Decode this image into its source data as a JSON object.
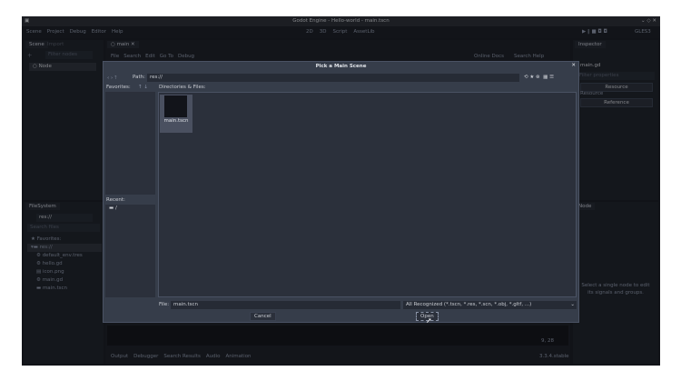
{
  "window": {
    "title": "Godot Engine - Hello-world - main.tscn"
  },
  "menu": [
    "Scene",
    "Project",
    "Debug",
    "Editor",
    "Help"
  ],
  "workspaces": [
    "2D",
    "3D",
    "Script",
    "AssetLib"
  ],
  "renderer": "GLES3",
  "scene_dock": {
    "tabs": [
      "Scene",
      "Import"
    ],
    "filter_placeholder": "Filter nodes",
    "root": "Node"
  },
  "editor": {
    "tab": "main",
    "menu": [
      "File",
      "Search",
      "Edit",
      "Go To",
      "Debug"
    ],
    "online_docs": "Online Docs",
    "search_help": "Search Help",
    "cursor": "9,  28",
    "version": "3.3.4.stable"
  },
  "bottom_tabs": [
    "Output",
    "Debugger",
    "Search Results",
    "Audio",
    "Animation"
  ],
  "filesystem": {
    "title": "FileSystem",
    "path": "res://",
    "search_placeholder": "Search files",
    "items": [
      "Favorites:",
      "res://",
      "default_env.tres",
      "hello.gd",
      "icon.png",
      "main.gd",
      "main.tscn"
    ]
  },
  "inspector": {
    "title": "Inspector",
    "file": "main.gd",
    "filter_placeholder": "Filter properties",
    "resource_btn": "Resource",
    "resource_label": "Resource",
    "reference_btn": "Reference"
  },
  "node_dock": {
    "tab": "Node",
    "message": "Select a single node to edit its signals and groups."
  },
  "dialog": {
    "title": "Pick a Main Scene",
    "path_label": "Path:",
    "path": "res://",
    "favorites_label": "Favorites:",
    "dirs_label": "Directories & Files:",
    "files": [
      "main.tscn"
    ],
    "recent_label": "Recent:",
    "recent": [
      "/"
    ],
    "file_label": "File:",
    "file_value": "main.tscn",
    "filter": "All Recognized (*.tscn, *.res, *.scn, *.obj, *.gltf, ...)",
    "cancel": "Cancel",
    "open": "Open"
  }
}
